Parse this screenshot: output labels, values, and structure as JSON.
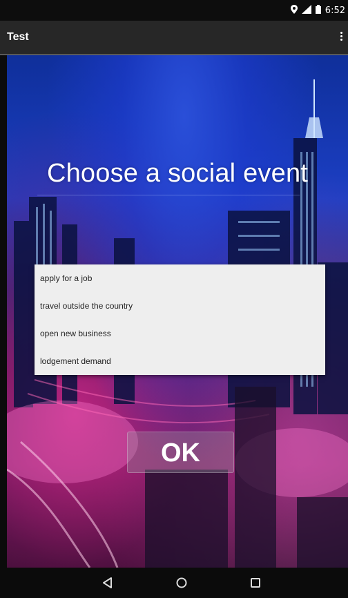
{
  "status_bar": {
    "time": "6:52",
    "icons": [
      "location-icon",
      "signal-icon",
      "battery-icon"
    ]
  },
  "action_bar": {
    "title": "Test",
    "overflow_icon": "overflow-menu-icon"
  },
  "main": {
    "headline": "Choose a social event",
    "options": [
      "apply for a job",
      "travel outside the country",
      "open new business",
      "lodgement demand"
    ],
    "ok_label": "OK"
  },
  "nav_bar": {
    "buttons": [
      "back-icon",
      "home-icon",
      "recents-icon"
    ]
  },
  "colors": {
    "action_bar": "#272727",
    "status_bar": "#0d0d0d",
    "list_background": "#eeeeee"
  }
}
